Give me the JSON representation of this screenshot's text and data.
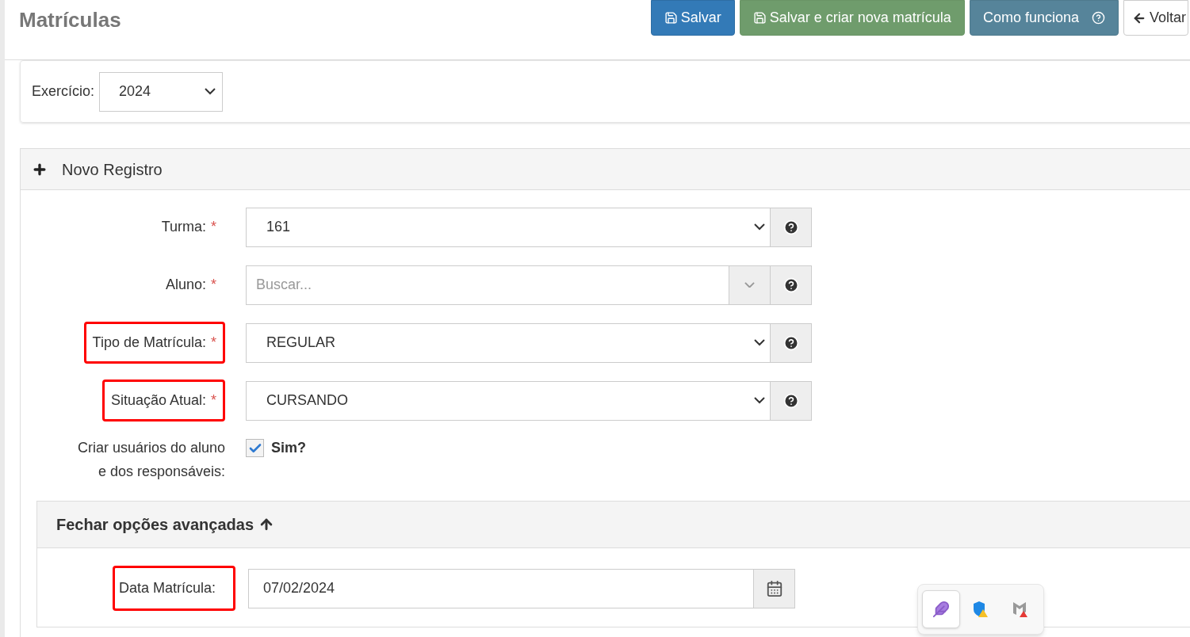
{
  "page": {
    "title": "Matrículas"
  },
  "actions": [
    {
      "kind": "save",
      "label": "Salvar"
    },
    {
      "kind": "save-new",
      "label": "Salvar e criar nova matrícula"
    },
    {
      "kind": "help",
      "label": "Como funciona"
    },
    {
      "kind": "back",
      "label": "Voltar"
    }
  ],
  "filter": {
    "label": "Exercício:",
    "value": "2024"
  },
  "panel": {
    "title": "Novo Registro",
    "fields": [
      {
        "kind": "select",
        "label": "Turma:",
        "required_mark": "*",
        "highlighted": false,
        "value": "161"
      },
      {
        "kind": "search",
        "label": "Aluno:",
        "required_mark": "*",
        "highlighted": false,
        "placeholder": "Buscar..."
      },
      {
        "kind": "select",
        "label": "Tipo de Matrícula:",
        "required_mark": "*",
        "highlighted": true,
        "value": "REGULAR"
      },
      {
        "kind": "select",
        "label": "Situação Atual:",
        "required_mark": "*",
        "highlighted": true,
        "value": "CURSANDO"
      },
      {
        "kind": "checkbox",
        "label_lines": [
          "Criar usuários do aluno",
          "e dos responsáveis:"
        ],
        "option": "Sim?",
        "checked": true
      }
    ],
    "advanced": {
      "title": "Fechar opções avançadas",
      "expanded": true,
      "fields": [
        {
          "kind": "date",
          "label": "Data Matrícula:",
          "highlighted": true,
          "value": "07/02/2024"
        }
      ]
    }
  },
  "tray": [
    {
      "kind": "feather",
      "selected": true
    },
    {
      "kind": "shield-warning",
      "selected": false
    },
    {
      "kind": "m-warning",
      "selected": false
    }
  ]
}
